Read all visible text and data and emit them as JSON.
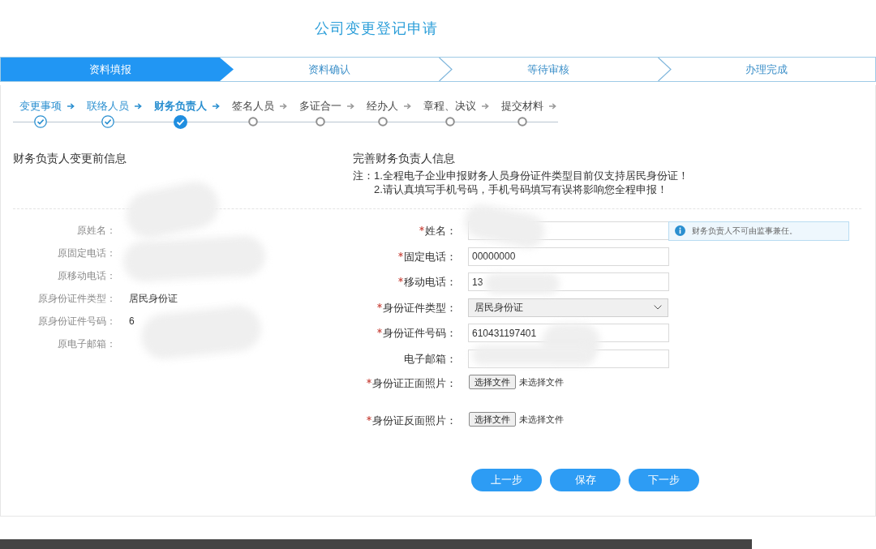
{
  "page_title": "公司变更登记申请",
  "progress_steps": [
    {
      "label": "资料填报",
      "selected": true
    },
    {
      "label": "资料确认",
      "selected": false
    },
    {
      "label": "等待审核",
      "selected": false
    },
    {
      "label": "办理完成",
      "selected": false
    }
  ],
  "sub_steps": [
    {
      "label": "变更事项",
      "completed": true,
      "selected": false
    },
    {
      "label": "联络人员",
      "completed": true,
      "selected": false
    },
    {
      "label": "财务负责人",
      "completed": true,
      "selected": true
    },
    {
      "label": "签名人员",
      "completed": false,
      "selected": false
    },
    {
      "label": "多证合一",
      "completed": false,
      "selected": false
    },
    {
      "label": "经办人",
      "completed": false,
      "selected": false
    },
    {
      "label": "章程、决议",
      "completed": false,
      "selected": false
    },
    {
      "label": "提交材料",
      "completed": false,
      "selected": false
    }
  ],
  "previous_info": {
    "title": "财务负责人变更前信息",
    "fields": [
      {
        "label": "原姓名："
      },
      {
        "label": "原固定电话："
      },
      {
        "label": "原移动电话："
      },
      {
        "label": "原身份证件类型：",
        "value": "居民身份证"
      },
      {
        "label": "原身份证件号码：",
        "value": "6"
      },
      {
        "label": "原电子邮箱："
      }
    ]
  },
  "form": {
    "title": "完善财务负责人信息",
    "note_label": "注：",
    "notes": [
      "1.全程电子企业申报财务人员身份证件类型目前仅支持居民身份证！",
      "2.请认真填写手机号码，手机号码填写有误将影响您全程申报！"
    ],
    "fields": [
      {
        "kind": "text",
        "label": "姓名：",
        "required": true,
        "hint": "财务负责人不可由监事兼任。"
      },
      {
        "kind": "text",
        "label": "固定电话：",
        "required": true,
        "value": "00000000"
      },
      {
        "kind": "text",
        "label": "移动电话：",
        "required": true,
        "value": "13"
      },
      {
        "kind": "select",
        "label": "身份证件类型：",
        "required": true,
        "value": "居民身份证"
      },
      {
        "kind": "text",
        "label": "身份证件号码：",
        "required": true,
        "value": "610431197401"
      },
      {
        "kind": "text",
        "label": "电子邮箱：",
        "required": false
      },
      {
        "kind": "file",
        "label": "身份证正面照片：",
        "required": true,
        "button": "选择文件",
        "file_status": "未选择文件"
      },
      {
        "kind": "file",
        "label": "身份证反面照片：",
        "required": true,
        "button": "选择文件",
        "file_status": "未选择文件"
      }
    ]
  },
  "buttons": [
    "上一步",
    "保存",
    "下一步"
  ]
}
